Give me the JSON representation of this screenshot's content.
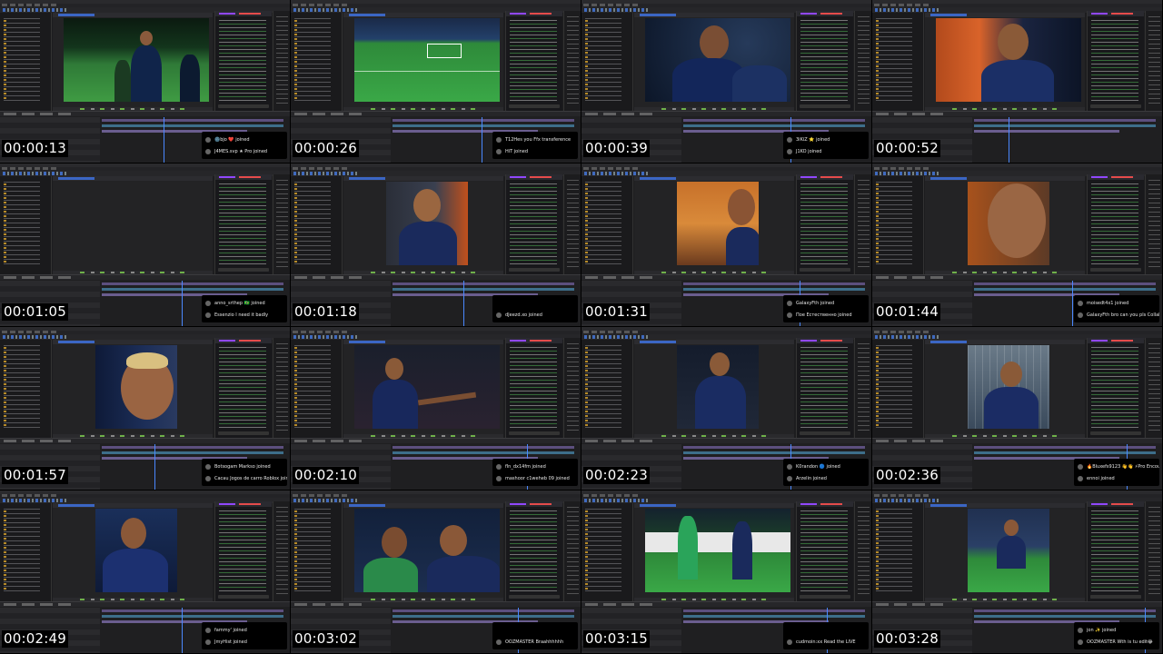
{
  "tiles": [
    {
      "time": "00:00:13",
      "scene": "pitch-walk",
      "n1": "🌚bjo ❤️ joined",
      "n2": "J4MES.svp ★ Pro joined"
    },
    {
      "time": "00:00:26",
      "scene": "pitch-wide",
      "n1": "T12Hes you Ffx transference",
      "n2": "HiT joined"
    },
    {
      "time": "00:00:39",
      "scene": "closeup-two",
      "n1": "3iKiZ ⭐ joined",
      "n2": "J1KO joined"
    },
    {
      "time": "00:00:52",
      "scene": "closeup-neymar",
      "n1": "",
      "n2": ""
    },
    {
      "time": "00:01:05",
      "scene": "empty",
      "n1": "anno_srthep 🇧🇷 joined",
      "n2": "Essenzio I need it badly"
    },
    {
      "time": "00:01:18",
      "scene": "portrait-orange",
      "n1": "",
      "n2": "dJeezd.xo joined"
    },
    {
      "time": "00:01:31",
      "scene": "portrait-side",
      "n1": "GalaxyFth joined",
      "n2": "Пое Естественно joined"
    },
    {
      "time": "00:01:44",
      "scene": "closeup-face",
      "n1": "moisedt4x1 joined",
      "n2": "GalaxyFth bro can you pls Collab with me"
    },
    {
      "time": "00:01:57",
      "scene": "blonde-head",
      "n1": "Botsogam Markso joined",
      "n2": "Cacau Jogos de carro Roblox joined"
    },
    {
      "time": "00:02:10",
      "scene": "gesture",
      "n1": "fln_dx14fm joined",
      "n2": "mashoor c1weheb 09 joined"
    },
    {
      "time": "00:02:23",
      "scene": "walking",
      "n1": "K0randon 🔵 joined",
      "n2": "Arzelin joined"
    },
    {
      "time": "00:02:36",
      "scene": "net-jersey",
      "n1": "🔥Bluxefs9123 👋👋 ⚡Pro Encounter",
      "n2": "ennoi joined"
    },
    {
      "time": "00:02:49",
      "scene": "blue-portrait",
      "n1": "fammy' joined",
      "n2": "JmyHist joined"
    },
    {
      "time": "00:03:02",
      "scene": "neymar-jersey",
      "n1": "",
      "n2": "OOZMASTER Braahhhhhh"
    },
    {
      "time": "00:03:15",
      "scene": "green-dribble",
      "n1": "",
      "n2": "cudmoin:xx Read the LIVE"
    },
    {
      "time": "00:03:28",
      "scene": "action-shot",
      "n1": "jon ✨ joined",
      "n2": "OOZMASTER Wth is tu edit😂"
    }
  ]
}
